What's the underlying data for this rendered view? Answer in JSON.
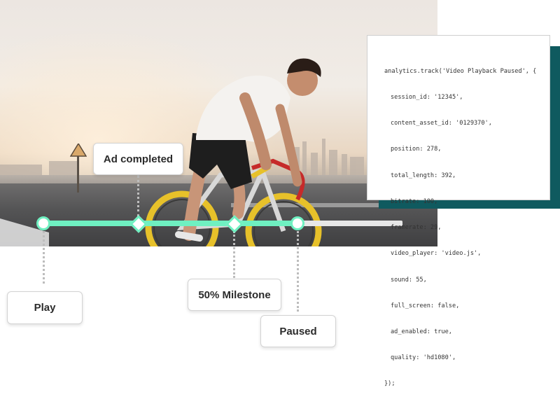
{
  "timeline": {
    "progress_fraction": 0.71,
    "events": {
      "play": "Play",
      "ad_completed": "Ad completed",
      "milestone": "50% Milestone",
      "paused": "Paused"
    }
  },
  "code": {
    "lines": [
      "analytics.track('Video Playback Paused', {",
      "session_id: '12345',",
      "content_asset_id: '0129370',",
      "position: 278,",
      "total_length: 392,",
      "bitrate: 100,",
      "framerate: 29,",
      "video_player: 'video.js',",
      "sound: 55,",
      "full_screen: false,",
      "ad_enabled: true,",
      "quality: 'hd1080',",
      "});"
    ]
  },
  "colors": {
    "timeline_accent": "#6ff0c1",
    "code_shadow": "#0f5a5f"
  }
}
